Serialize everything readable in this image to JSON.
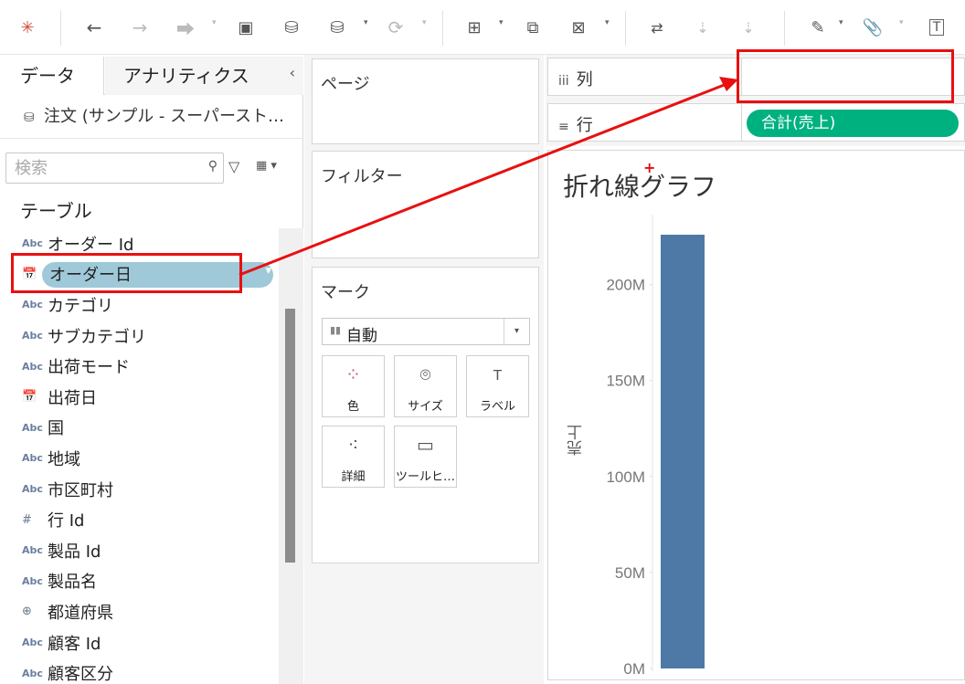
{
  "toolbar": {
    "icons": [
      "tableau-logo-icon",
      "back-arrow-icon",
      "forward-arrow-icon",
      "redo-icon",
      "save-icon",
      "new-datasource-icon",
      "pause-update-icon",
      "refresh-icon",
      "new-worksheet-icon",
      "duplicate-sheet-icon",
      "clear-sheet-icon",
      "swap-rows-columns-icon",
      "sort-ascending-icon",
      "sort-descending-icon",
      "highlight-icon",
      "group-members-icon",
      "show-mark-labels-icon"
    ]
  },
  "datapane": {
    "tabs": {
      "data": "データ",
      "analytics": "アナリティクス"
    },
    "datasource_label": "注文 (サンプル - スーパースト…",
    "search_placeholder": "検索",
    "section_label": "テーブル",
    "fields": [
      {
        "type": "Abc",
        "kind": "text",
        "name": "オーダー Id",
        "selected": false
      },
      {
        "type": "📅",
        "kind": "date",
        "name": "オーダー日",
        "selected": true
      },
      {
        "type": "Abc",
        "kind": "text",
        "name": "カテゴリ",
        "selected": false
      },
      {
        "type": "Abc",
        "kind": "text",
        "name": "サブカテゴリ",
        "selected": false
      },
      {
        "type": "Abc",
        "kind": "text",
        "name": "出荷モード",
        "selected": false
      },
      {
        "type": "📅",
        "kind": "date",
        "name": "出荷日",
        "selected": false
      },
      {
        "type": "Abc",
        "kind": "text",
        "name": "国",
        "selected": false
      },
      {
        "type": "Abc",
        "kind": "text",
        "name": "地域",
        "selected": false
      },
      {
        "type": "Abc",
        "kind": "text",
        "name": "市区町村",
        "selected": false
      },
      {
        "type": "#",
        "kind": "number",
        "name": "行 Id",
        "selected": false
      },
      {
        "type": "Abc",
        "kind": "text",
        "name": "製品 Id",
        "selected": false
      },
      {
        "type": "Abc",
        "kind": "text",
        "name": "製品名",
        "selected": false
      },
      {
        "type": "⊕",
        "kind": "geo",
        "name": "都道府県",
        "selected": false
      },
      {
        "type": "Abc",
        "kind": "text",
        "name": "顧客 Id",
        "selected": false
      },
      {
        "type": "Abc",
        "kind": "text",
        "name": "顧客区分",
        "selected": false
      }
    ]
  },
  "cards": {
    "pages": "ページ",
    "filters": "フィルター",
    "marks": {
      "title": "マーク",
      "type_selected": "自動",
      "buttons": [
        {
          "icon": "color-icon",
          "glyph": "⁘",
          "label": "色"
        },
        {
          "icon": "size-icon",
          "glyph": "⌾",
          "label": "サイズ"
        },
        {
          "icon": "label-icon",
          "glyph": "T",
          "label": "ラベル"
        },
        {
          "icon": "detail-icon",
          "glyph": "⁖",
          "label": "詳細"
        },
        {
          "icon": "tooltip-icon",
          "glyph": "▭",
          "label": "ツールヒ…"
        }
      ]
    }
  },
  "shelves": {
    "columns": {
      "icon": "iii",
      "label": "列"
    },
    "rows": {
      "icon": "≡",
      "label": "行",
      "pill": "合計(売上)"
    }
  },
  "view": {
    "title": "折れ線グラフ",
    "y_axis_title": "売上"
  },
  "chart_data": {
    "type": "bar",
    "categories": [
      ""
    ],
    "values": [
      226
    ],
    "ylabel": "売上",
    "yunit": "M",
    "ylim": [
      0,
      226
    ],
    "yticks": [
      0,
      50,
      100,
      150,
      200
    ],
    "ytick_labels": [
      "0M",
      "50M",
      "100M",
      "150M",
      "200M"
    ],
    "bar_color": "#4e79a7",
    "grid": false
  },
  "colors": {
    "measure_pill": "#00b180",
    "dimension_pill_selected": "#9fc9d8",
    "annotation": "#e81010"
  }
}
